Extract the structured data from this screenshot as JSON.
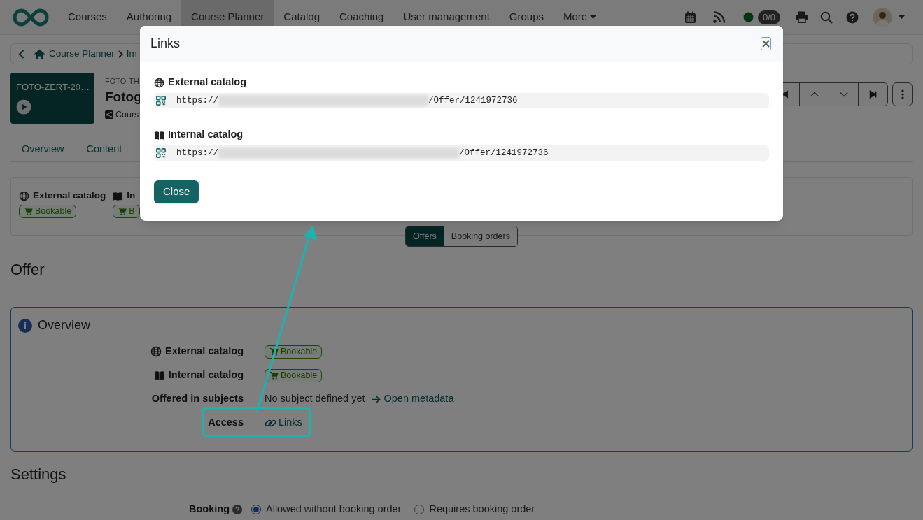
{
  "top_nav": {
    "items": [
      {
        "label": "Courses",
        "selected": false
      },
      {
        "label": "Authoring",
        "selected": false
      },
      {
        "label": "Course Planner",
        "selected": true
      },
      {
        "label": "Catalog",
        "selected": false
      },
      {
        "label": "Coaching",
        "selected": false
      },
      {
        "label": "User management",
        "selected": false
      },
      {
        "label": "Groups",
        "selected": false
      }
    ],
    "more": "More",
    "badge": "0/0"
  },
  "breadcrumb": [
    "Course Planner",
    "Im"
  ],
  "course": {
    "thumb_label": "FOTO-ZERT-20…",
    "code": "FOTO-TH",
    "title": "Fotog",
    "type": "Cours"
  },
  "tabs": [
    "Overview",
    "Content"
  ],
  "catalog_panel": [
    {
      "kind": "external",
      "label": "External catalog",
      "badge": "Bookable"
    },
    {
      "kind": "internal",
      "label": "In",
      "badge": "B"
    }
  ],
  "view_switch": [
    {
      "label": "Offers",
      "selected": true
    },
    {
      "label": "Booking orders",
      "selected": false
    }
  ],
  "offer_heading": "Offer",
  "overview": {
    "title": "Overview",
    "rows": [
      {
        "kind": "external",
        "label": "External catalog",
        "badge": "Bookable"
      },
      {
        "kind": "internal",
        "label": "Internal catalog",
        "badge": "Bookable"
      },
      {
        "kind": "text",
        "label": "Offered in subjects",
        "value": "No subject defined yet",
        "link": "Open metadata"
      },
      {
        "kind": "access",
        "label": "Access",
        "link": "Links",
        "highlighted": true
      }
    ]
  },
  "settings_heading": "Settings",
  "booking": {
    "label": "Booking",
    "options": [
      {
        "label": "Allowed without booking order",
        "selected": true
      },
      {
        "label": "Requires booking order",
        "selected": false
      }
    ]
  },
  "dialog": {
    "title": "Links",
    "sections": [
      {
        "kind": "external",
        "heading": "External catalog",
        "url_start": "https://",
        "url_end": "/Offer/1241972736"
      },
      {
        "kind": "internal",
        "heading": "Internal catalog",
        "url_start": "https://",
        "url_end": "/Offer/1241972736"
      }
    ],
    "close_button": "Close"
  }
}
